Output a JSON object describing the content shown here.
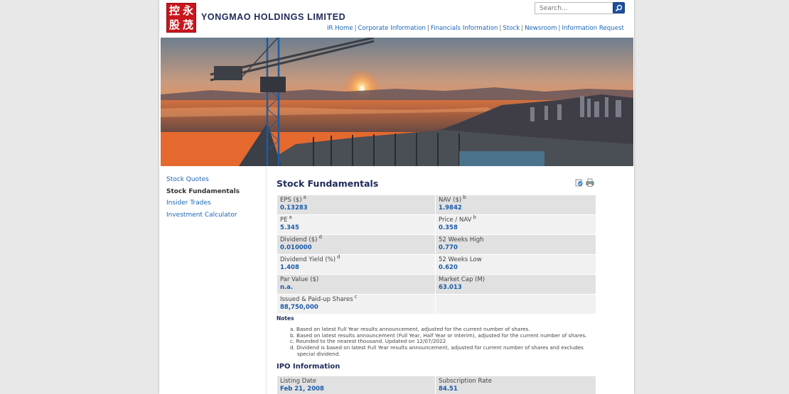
{
  "header": {
    "logo_chars": [
      "控",
      "永",
      "股",
      "茂"
    ],
    "company_name": "YONGMAO HOLDINGS LIMITED",
    "search_placeholder": "Search..."
  },
  "top_nav": [
    {
      "label": "IR Home"
    },
    {
      "label": "Corporate Information"
    },
    {
      "label": "Financials Information"
    },
    {
      "label": "Stock"
    },
    {
      "label": "Newsroom"
    },
    {
      "label": "Information Request"
    }
  ],
  "side_nav": [
    {
      "label": "Stock Quotes",
      "active": false
    },
    {
      "label": "Stock Fundamentals",
      "active": true
    },
    {
      "label": "Insider Trades",
      "active": false
    },
    {
      "label": "Investment Calculator",
      "active": false
    }
  ],
  "main": {
    "title": "Stock Fundamentals",
    "tools": [
      "email-page-icon",
      "print-icon"
    ],
    "fundamentals": [
      {
        "left": {
          "label": "EPS ($)",
          "sup": "a",
          "value": "0.13283"
        },
        "right": {
          "label": "NAV ($)",
          "sup": "b",
          "value": "1.9842"
        }
      },
      {
        "left": {
          "label": "PE",
          "sup": "a",
          "value": "5.345"
        },
        "right": {
          "label": "Price / NAV",
          "sup": "b",
          "value": "0.358"
        }
      },
      {
        "left": {
          "label": "Dividend ($)",
          "sup": "d",
          "value": "0.010000"
        },
        "right": {
          "label": "52 Weeks High",
          "sup": "",
          "value": "0.770"
        }
      },
      {
        "left": {
          "label": "Dividend Yield (%)",
          "sup": "d",
          "value": "1.408"
        },
        "right": {
          "label": "52 Weeks Low",
          "sup": "",
          "value": "0.620"
        }
      },
      {
        "left": {
          "label": "Par Value ($)",
          "sup": "",
          "value": "n.a."
        },
        "right": {
          "label": "Market Cap (M)",
          "sup": "",
          "value": "63.013"
        }
      },
      {
        "left": {
          "label": "Issued & Paid-up Shares",
          "sup": "c",
          "value": "88,750,000"
        },
        "right": {
          "label": "",
          "sup": "",
          "value": ""
        }
      }
    ],
    "notes_title": "Notes",
    "notes": [
      "a. Based on latest Full Year results announcement, adjusted for the current number of shares.",
      "b. Based on latest results announcement (Full Year, Half Year or Interim), adjusted for the current number of shares.",
      "c. Rounded to the nearest thousand. Updated on 12/07/2022",
      "d. Dividend is based on latest Full Year results announcement, adjusted for current number of shares and excludes special dividend."
    ],
    "ipo_title": "IPO Information",
    "ipo": [
      {
        "left": {
          "label": "Listing Date",
          "sup": "",
          "value": "Feb 21, 2008"
        },
        "right": {
          "label": "Subscription Rate",
          "sup": "",
          "value": "84.51"
        }
      }
    ]
  },
  "colors": {
    "brand_red": "#c8161d",
    "link_blue": "#1a66b3",
    "heading_navy": "#1e2a5a",
    "value_blue": "#1a5aa8"
  }
}
